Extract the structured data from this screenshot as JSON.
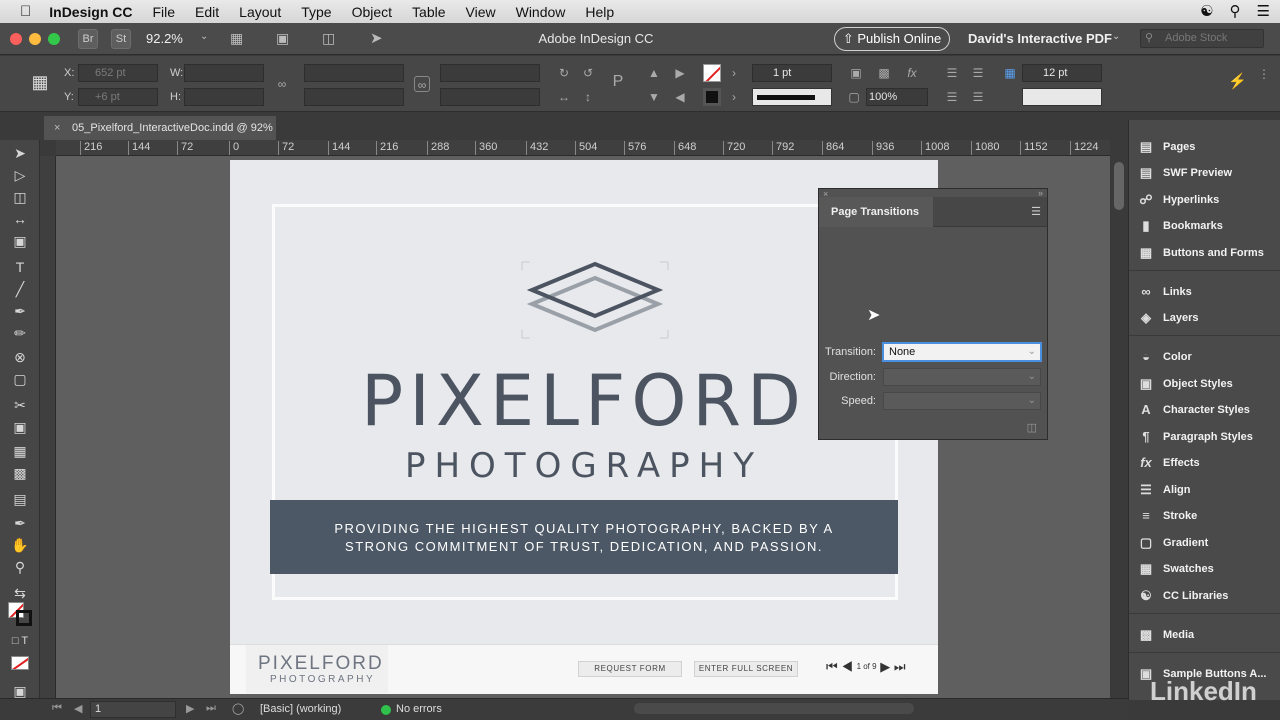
{
  "menubar": {
    "apple": "",
    "app_name": "InDesign CC",
    "items": [
      "File",
      "Edit",
      "Layout",
      "Type",
      "Object",
      "Table",
      "View",
      "Window",
      "Help"
    ]
  },
  "appbar": {
    "bridge": "Br",
    "stock": "St",
    "zoom": "92.2%",
    "window_title": "Adobe InDesign CC",
    "publish_label": "Publish Online",
    "workspace": "David's Interactive PDF",
    "search_placeholder": "Adobe Stock"
  },
  "control": {
    "x_label": "X:",
    "x_value": "652 pt",
    "y_label": "Y:",
    "y_value": "+6 pt",
    "w_label": "W:",
    "h_label": "H:",
    "stroke_weight": "1 pt",
    "opacity": "100%",
    "spacing": "12 pt"
  },
  "document_tab": {
    "label": "05_Pixelford_InteractiveDoc.indd @ 92%"
  },
  "ruler": {
    "ticks": [
      "216",
      "144",
      "72",
      "0",
      "72",
      "144",
      "216",
      "288",
      "360",
      "432",
      "504",
      "576",
      "648",
      "720",
      "792",
      "864",
      "936",
      "1008",
      "1080",
      "1152",
      "1224"
    ]
  },
  "page": {
    "brand": "PIXELFORD",
    "subtitle": "PHOTOGRAPHY",
    "banner_line1": "PROVIDING THE HIGHEST QUALITY PHOTOGRAPHY, BACKED BY A",
    "banner_line2": "STRONG COMMITMENT OF TRUST, DEDICATION, AND PASSION.",
    "footer_logo_1": "PIXELFORD",
    "footer_logo_2": "PHOTOGRAPHY",
    "btn_request": "REQUEST FORM",
    "btn_fullscreen": "ENTER FULL SCREEN",
    "pager_text": "1 of 9"
  },
  "page_transitions": {
    "title": "Page Transitions",
    "transition_label": "Transition:",
    "transition_value": "None",
    "direction_label": "Direction:",
    "speed_label": "Speed:"
  },
  "right_panels": {
    "group1": [
      {
        "label": "Pages",
        "icon": "pages-icon"
      },
      {
        "label": "SWF Preview",
        "icon": "swf-preview-icon"
      },
      {
        "label": "Hyperlinks",
        "icon": "hyperlinks-icon"
      },
      {
        "label": "Bookmarks",
        "icon": "bookmarks-icon"
      },
      {
        "label": "Buttons and Forms",
        "icon": "buttons-forms-icon"
      }
    ],
    "group2": [
      {
        "label": "Links",
        "icon": "links-icon"
      },
      {
        "label": "Layers",
        "icon": "layers-icon"
      }
    ],
    "group3": [
      {
        "label": "Color",
        "icon": "color-icon"
      },
      {
        "label": "Object Styles",
        "icon": "object-styles-icon"
      },
      {
        "label": "Character Styles",
        "icon": "character-styles-icon"
      },
      {
        "label": "Paragraph Styles",
        "icon": "paragraph-styles-icon"
      },
      {
        "label": "Effects",
        "icon": "effects-icon"
      },
      {
        "label": "Align",
        "icon": "align-icon"
      },
      {
        "label": "Stroke",
        "icon": "stroke-icon"
      },
      {
        "label": "Gradient",
        "icon": "gradient-icon"
      },
      {
        "label": "Swatches",
        "icon": "swatches-icon"
      },
      {
        "label": "CC Libraries",
        "icon": "cc-libraries-icon"
      }
    ],
    "group4": [
      {
        "label": "Media",
        "icon": "media-icon"
      }
    ],
    "group5": [
      {
        "label": "Sample Buttons A...",
        "icon": "sample-buttons-icon"
      }
    ]
  },
  "status": {
    "page_number": "1",
    "preflight_profile": "[Basic] (working)",
    "errors": "No errors"
  },
  "watermark": "LinkedIn",
  "colors": {
    "banner": "#4c5866",
    "brand_text": "#4b5460",
    "page_bg": "#e8e9ec",
    "focus": "#4b8fe0"
  }
}
